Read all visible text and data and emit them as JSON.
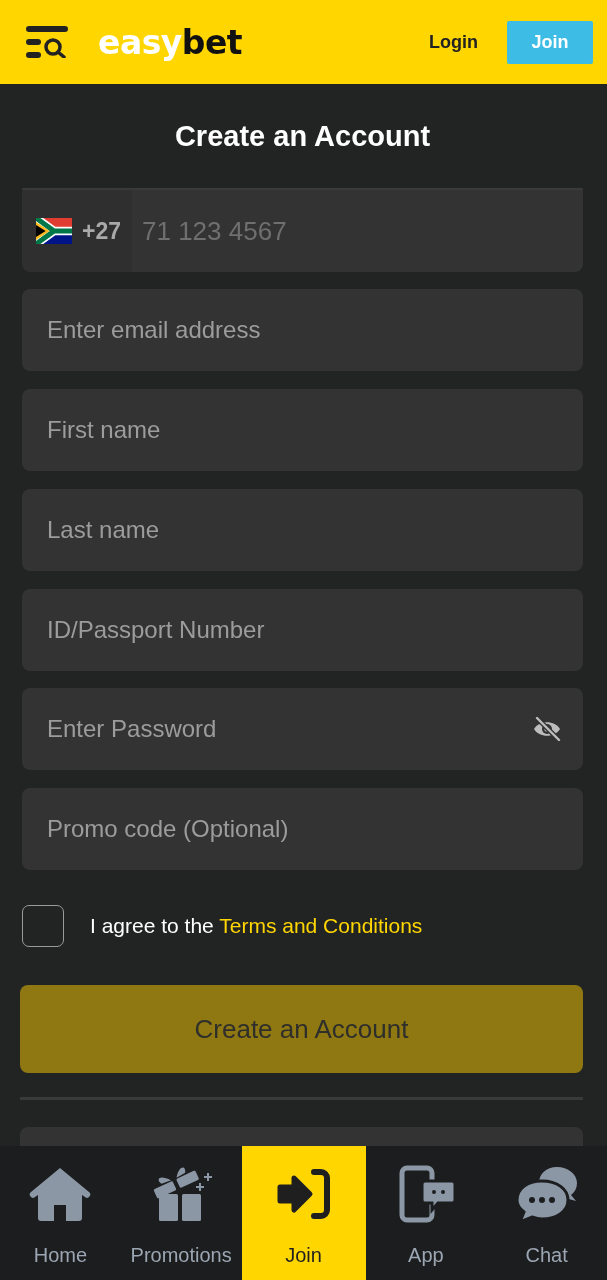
{
  "header": {
    "logo_parts": [
      "easy",
      "bet"
    ],
    "login": "Login",
    "join": "Join"
  },
  "title": "Create an Account",
  "phone": {
    "country_code": "+27",
    "placeholder": "71 123 4567"
  },
  "fields": [
    {
      "kind": "text",
      "placeholder": "Enter email address"
    },
    {
      "kind": "text",
      "placeholder": "First name"
    },
    {
      "kind": "text",
      "placeholder": "Last name"
    },
    {
      "kind": "text",
      "placeholder": "ID/Passport Number"
    },
    {
      "kind": "password",
      "placeholder": "Enter Password"
    },
    {
      "kind": "text",
      "placeholder": "Promo code (Optional)"
    }
  ],
  "terms": {
    "checked": false,
    "text": "I agree to the",
    "link": "Terms and Conditions"
  },
  "submit": {
    "label": "Create an Account",
    "disabled": true
  },
  "bottom_nav": [
    {
      "label": "Home",
      "selected": false
    },
    {
      "label": "Promotions",
      "selected": false
    },
    {
      "label": "Join",
      "selected": true
    },
    {
      "label": "App",
      "selected": false
    },
    {
      "label": "Chat",
      "selected": false
    }
  ]
}
